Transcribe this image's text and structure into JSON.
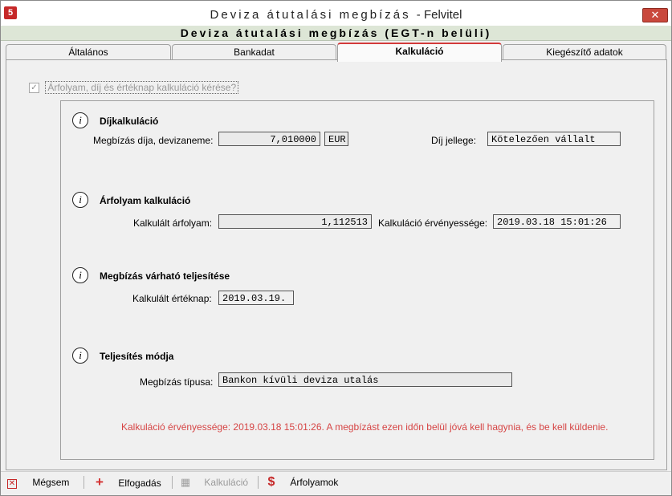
{
  "window": {
    "title": "Deviza átutalási megbízás",
    "title_suffix": "- Felvitel",
    "subtitle": "Deviza átutalási megbízás (EGT-n belüli)",
    "close_glyph": "✕",
    "app_icon_glyph": "5"
  },
  "tabs": [
    {
      "label": "Általános",
      "active": false
    },
    {
      "label": "Bankadat",
      "active": false
    },
    {
      "label": "Kalkuláció",
      "active": true
    },
    {
      "label": "Kiegészítő adatok",
      "active": false
    }
  ],
  "checkbox": {
    "label": "Árfolyam, díj és értéknap kalkuláció kérése?",
    "checked": true
  },
  "sections": {
    "dij": {
      "title": "Díjkalkuláció",
      "fee_label": "Megbízás díja, devizaneme:",
      "fee_value": "7,010000",
      "fee_currency": "EUR",
      "type_label": "Díj jellege:",
      "type_value": "Kötelezően vállalt"
    },
    "arfolyam": {
      "title": "Árfolyam kalkuláció",
      "rate_label": "Kalkulált árfolyam:",
      "rate_value": "1,112513",
      "validity_label": "Kalkuláció érvényessége:",
      "validity_value": "2019.03.18 15:01:26"
    },
    "teljesites": {
      "title": "Megbízás várható teljesítése",
      "date_label": "Kalkulált értéknap:",
      "date_value": "2019.03.19."
    },
    "mod": {
      "title": "Teljesítés módja",
      "type_label": "Megbízás típusa:",
      "type_value": "Bankon kívüli deviza utalás"
    }
  },
  "warning": "Kalkuláció érvényessége: 2019.03.18 15:01:26. A megbízást ezen időn belül jóvá kell hagynia, és be kell küldenie.",
  "toolbar": {
    "cancel": "Mégsem",
    "accept": "Elfogadás",
    "calc": "Kalkuláció",
    "rates": "Árfolyamok"
  },
  "colors": {
    "active_tab_accent": "#d33a3a",
    "warning_text": "#d64545",
    "subtitle_bg": "#dde6d6"
  },
  "icons": {
    "section": "info-icon",
    "cancel": "close-box-icon",
    "accept": "plus-icon",
    "calc": "grid-icon",
    "rates": "dollar-icon"
  }
}
